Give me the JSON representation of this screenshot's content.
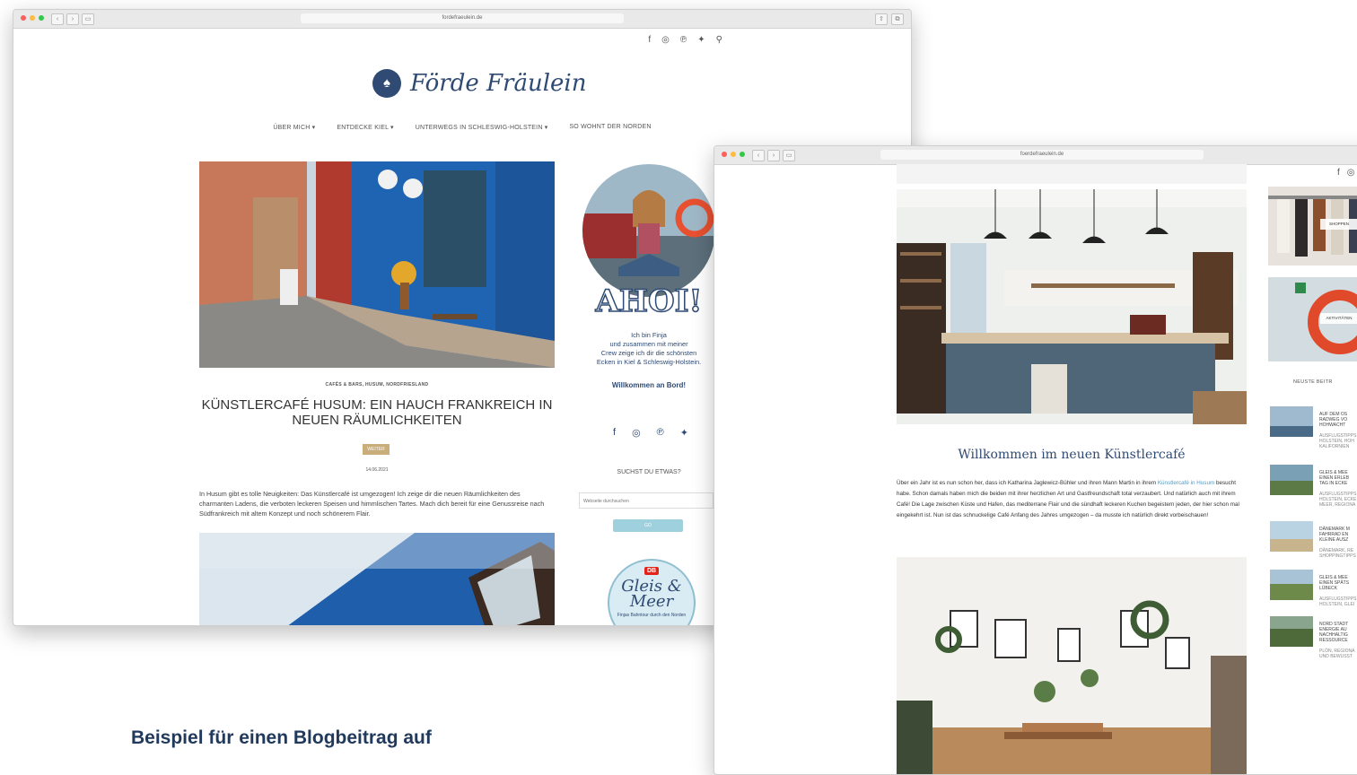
{
  "window1": {
    "url": "forde­fraeulein.de",
    "top_social_icons": [
      "facebook-icon",
      "instagram-icon",
      "pinterest-icon",
      "twitter-icon",
      "search-icon"
    ],
    "logo_text": "Förde Fräulein",
    "nav": [
      "ÜBER MICH ▾",
      "ENTDECKE KIEL ▾",
      "UNTERWEGS IN SCHLESWIG-HOLSTEIN ▾",
      "SO WOHNT DER NORDEN"
    ],
    "post": {
      "categories": "CAFÉS & BARS, HUSUM, NORDFRIESLAND",
      "title": "KÜNSTLERCAFÉ HUSUM: EIN HAUCH FRANKREICH IN NEUEN RÄUMLICHKEITEN",
      "tag": "WEITER",
      "date": "14.06.2021",
      "excerpt": "In Husum gibt es tolle Neuigkeiten: Das Künstlercafé ist umgezogen! Ich zeige dir die neuen Räumlichkeiten des charmanten Ladens, die verboten leckeren Speisen und himmlischen Tartes. Mach dich bereit für eine Genussreise nach Südfrankreich mit altem Konzept und noch schönerem Flair."
    },
    "sidebar": {
      "ahoi": "AHOI!",
      "intro_lines": [
        "Ich bin Finja",
        "und zusammen mit meiner",
        "Crew zeige ich dir die schönsten",
        "Ecken in Kiel & Schleswig-Holstein."
      ],
      "welcome": "Willkommen an Bord!",
      "search_heading": "SUCHST DU ETWAS?",
      "search_placeholder": "Webseite durchsuchen",
      "search_button": "GO",
      "gleis_badge": "DB",
      "gleis_title": "Gleis & Meer",
      "gleis_sub": "Finjas Bahntour durch den Norden"
    }
  },
  "window2": {
    "url": "foerdefraeulein.de",
    "heading": "Willkommen im neuen Künstlercafé",
    "body_1": "Über ein Jahr ist es nun schon her, dass ich Katharina Jaglewicz-Bühler und ihren Mann Martin in ihrem",
    "body_link": "Künstlercafé in Husum",
    "body_2": " besucht habe. Schon damals haben mich die beiden mit ihrer herzlichen Art und Gastfreundschaft total verzaubert. Und natürlich auch mit ihrem Café! Die Lage zwischen Küste und Hafen, das mediterrane Flair und die sündhaft leckeren Kuchen begeistern jeden, der hier schon mal eingekehrt ist. Nun ist das schnuckelige Café Anfang des Jahres umgezogen – da musste ich natürlich direkt vorbeischauen!",
    "shop_label": "SHOPPEN",
    "activities_label": "AKTIVITÄTEN",
    "newest_heading": "NEUSTE BEITR",
    "list": [
      {
        "title": "AUF DEM OS\nRADWEG VO\nHOHWACHT",
        "sub": "AUSFLUGSTIPPS\nHOLSTEIN, HOH\nKALIFORNIEN"
      },
      {
        "title": "GLEIS & MEE\nEINEN ERLEB\nTAG IN ECKE",
        "sub": "AUSFLUGSTIPPS\nHOLSTEIN, ECKE\nMEER, REGIONA"
      },
      {
        "title": "DÄNEMARK M\nFAHRRAD EN\nKLEINE AUSZ",
        "sub": "DÄNEMARK, RE\nSHOPPINGTIPPS"
      },
      {
        "title": "GLEIS & MEE\nEINEN SPÄTS\nLÜBECK",
        "sub": "AUSFLUGSTIPPS\nHOLSTEIN, GLEI"
      },
      {
        "title": "NORD STADT\nENERGIE AU\nNACHHALTIG\nRESSOURCE",
        "sub": "PLÖN, REGIONA\nUND BEWUSST"
      }
    ]
  },
  "caption": "Beispiel für einen Blogbeitrag auf"
}
